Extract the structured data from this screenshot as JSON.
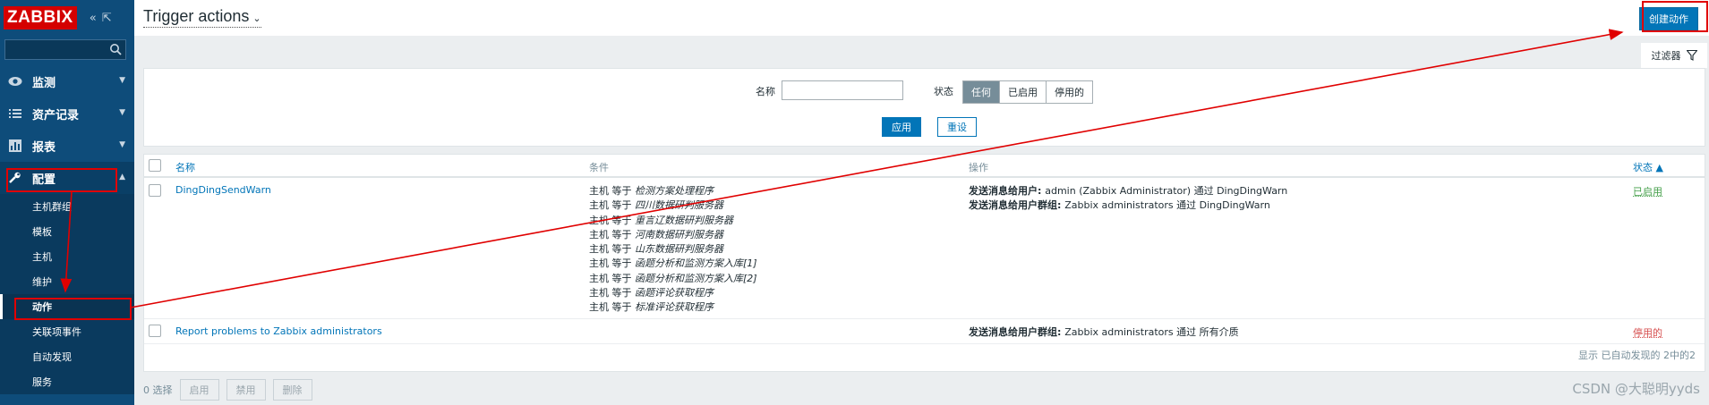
{
  "sidebar": {
    "logo": "ZABBIX",
    "collapse_icon": "«",
    "expand_icon": "⇱",
    "menu": [
      {
        "label": "监测",
        "icon": "eye-icon"
      },
      {
        "label": "资产记录",
        "icon": "list-icon"
      },
      {
        "label": "报表",
        "icon": "bar-chart-icon"
      },
      {
        "label": "配置",
        "icon": "wrench-icon"
      }
    ],
    "submenu": [
      "主机群组",
      "模板",
      "主机",
      "维护",
      "动作",
      "关联项事件",
      "自动发现",
      "服务"
    ],
    "selected_sub": "动作"
  },
  "header": {
    "title": "Trigger actions",
    "title_chevron": "⌄",
    "create_button": "创建动作",
    "filter_tab": "过滤器"
  },
  "filter": {
    "name_label": "名称",
    "name_value": "",
    "status_label": "状态",
    "status_options": [
      "任何",
      "已启用",
      "停用的"
    ],
    "status_selected": "任何",
    "apply": "应用",
    "reset": "重设"
  },
  "table": {
    "headers": {
      "name": "名称",
      "conditions": "条件",
      "operations": "操作",
      "status": "状态 ▲"
    },
    "rows": [
      {
        "name": "DingDingSendWarn",
        "conditions": [
          {
            "k": "主机 等于 ",
            "v": "检测方案处理程序"
          },
          {
            "k": "主机 等于 ",
            "v": "四川数据研判服务器"
          },
          {
            "k": "主机 等于 ",
            "v": "重言辽数据研判服务器"
          },
          {
            "k": "主机 等于 ",
            "v": "河南数据研判服务器"
          },
          {
            "k": "主机 等于 ",
            "v": "山东数据研判服务器"
          },
          {
            "k": "主机 等于 ",
            "v": "函题分析和监测方案入库[1]"
          },
          {
            "k": "主机 等于 ",
            "v": "函题分析和监测方案入库[2]"
          },
          {
            "k": "主机 等于 ",
            "v": "函题评论获取程序"
          },
          {
            "k": "主机 等于 ",
            "v": "标准评论获取程序"
          }
        ],
        "operations": [
          {
            "b": "发送消息给用户: ",
            "t": "admin (Zabbix Administrator) 通过 DingDingWarn"
          },
          {
            "b": "发送消息给用户群组: ",
            "t": "Zabbix administrators 通过 DingDingWarn"
          }
        ],
        "status": "已启用",
        "status_color": "#429e47"
      },
      {
        "name": "Report problems to Zabbix administrators",
        "conditions": [],
        "operations": [
          {
            "b": "发送消息给用户群组: ",
            "t": "Zabbix administrators 通过 所有介质"
          }
        ],
        "status": "停用的",
        "status_color": "#d64e4e"
      }
    ],
    "footer": "显示 已自动发现的 2中的2"
  },
  "bottom": {
    "selected": "0 选择",
    "buttons": [
      "启用",
      "禁用",
      "删除"
    ]
  },
  "watermark": "CSDN @大聪明yyds",
  "colors": {
    "annotation": "#e00000",
    "sidebar": "#0e4c7a",
    "accent": "#0275b8"
  }
}
